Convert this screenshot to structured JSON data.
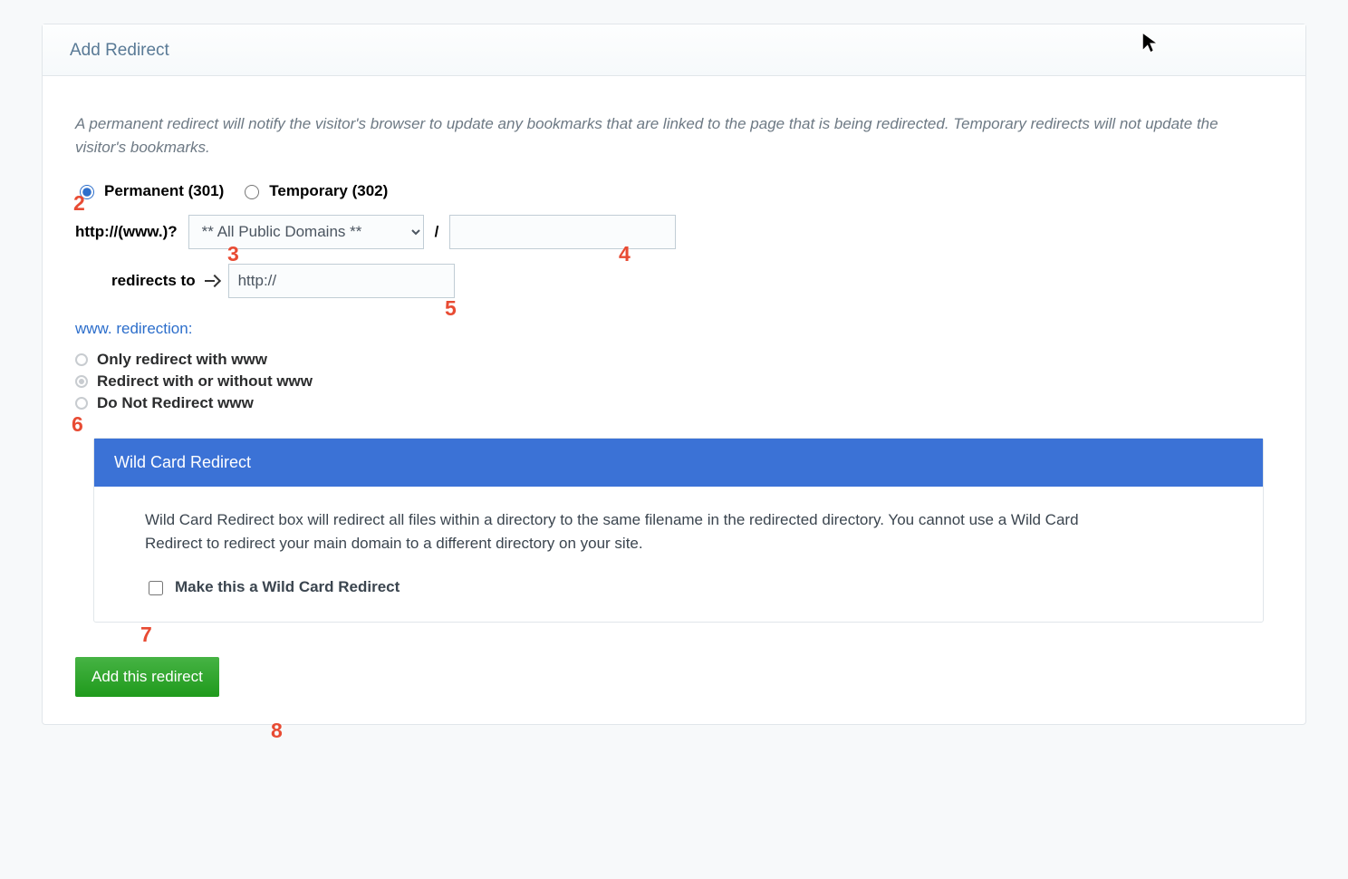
{
  "card": {
    "title": "Add Redirect",
    "intro": "A permanent redirect will notify the visitor's browser to update any bookmarks that are linked to the page that is being redirected. Temporary redirects will not update the visitor's bookmarks."
  },
  "redirect_type": {
    "permanent_label": "Permanent (301)",
    "temporary_label": "Temporary (302)",
    "selected": "permanent"
  },
  "source": {
    "prefix_label": "http://(www.)?",
    "domain_selected": "** All Public Domains **",
    "slash_label": "/",
    "path_value": ""
  },
  "destination": {
    "label": "redirects to",
    "value": "http://"
  },
  "www": {
    "heading": "www. redirection:",
    "option_only": "Only redirect with www",
    "option_either": "Redirect with or without www",
    "option_none": "Do Not Redirect www",
    "selected": "either"
  },
  "wildcard": {
    "panel_title": "Wild Card Redirect",
    "description": "Wild Card Redirect box will redirect all files within a directory to the same filename in the redirected directory. You cannot use a Wild Card Redirect to redirect your main domain to a different directory on your site.",
    "checkbox_label": "Make this a Wild Card Redirect",
    "checked": false
  },
  "submit": {
    "label": "Add this redirect"
  },
  "annotations": {
    "n2": "2",
    "n3": "3",
    "n4": "4",
    "n5": "5",
    "n6": "6",
    "n7": "7",
    "n8": "8"
  }
}
